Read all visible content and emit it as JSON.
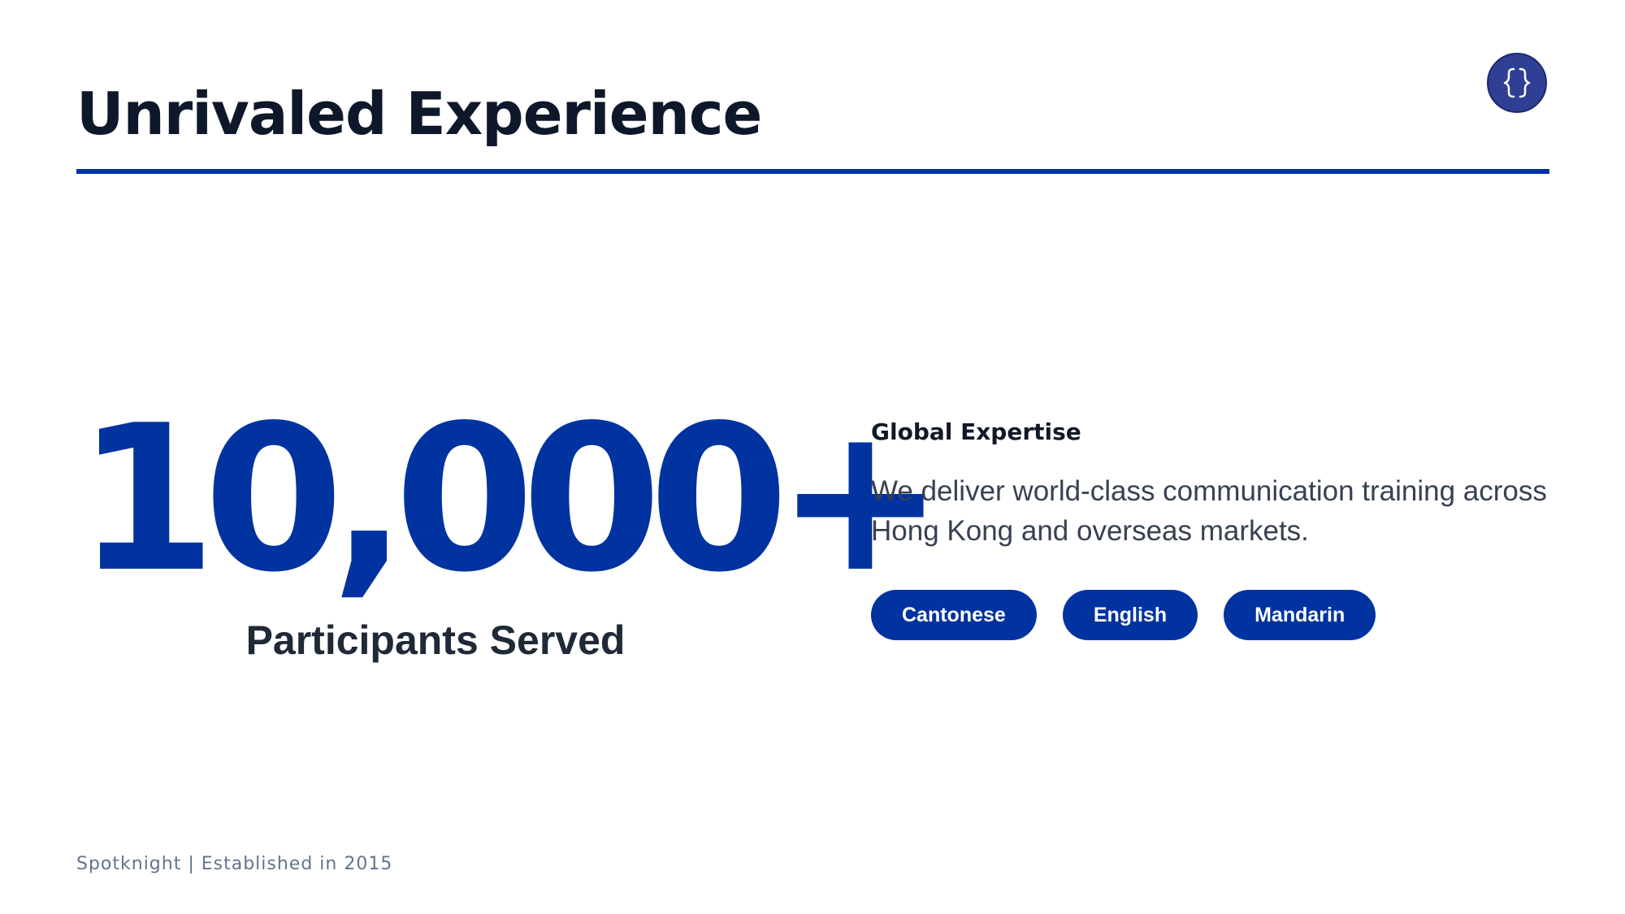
{
  "header": {
    "title": "Unrivaled Experience",
    "logo_icon": "curly-braces-logo-icon"
  },
  "stat": {
    "value": "10,000+",
    "caption": "Participants Served"
  },
  "details": {
    "kicker": "Global Expertise",
    "description": "We deliver world-class communication training across Hong Kong and overseas markets.",
    "languages": [
      "Cantonese",
      "English",
      "Mandarin"
    ]
  },
  "footer": {
    "text": "Spotknight | Established in 2015"
  },
  "colors": {
    "brand_blue": "#0033a0",
    "logo_blue": "#2f3f94",
    "title_text": "#0f172a",
    "footer_text": "#64748b"
  }
}
